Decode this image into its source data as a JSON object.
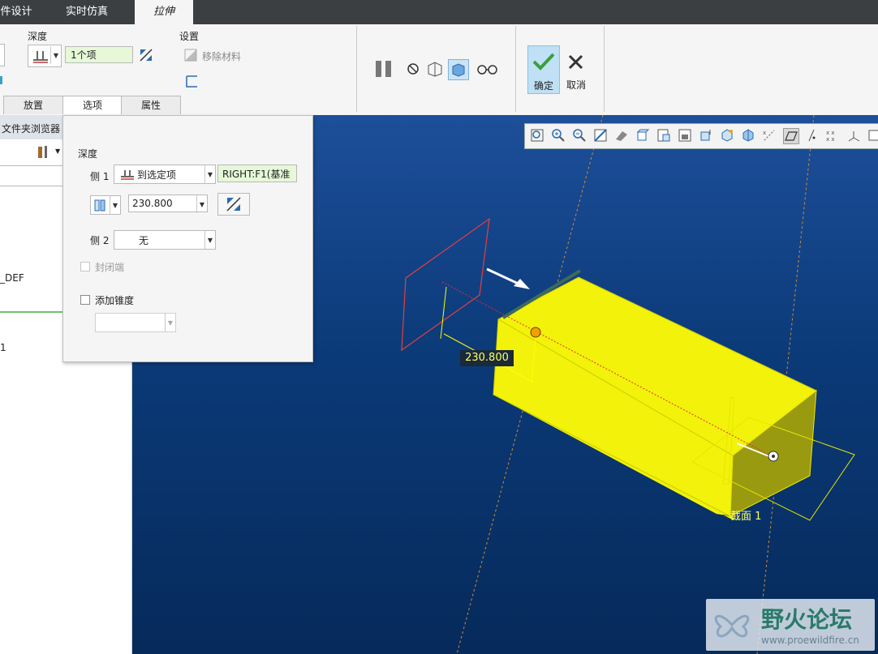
{
  "tabs": [
    {
      "label": "件设计",
      "active": false
    },
    {
      "label": "实时仿真",
      "active": false
    },
    {
      "label": "拉伸",
      "active": true
    }
  ],
  "ribbon": {
    "depth_label": "深度",
    "depth_value": "1个项",
    "settings_label": "设置",
    "remove_material_label": "移除材料",
    "ok_label": "确定",
    "cancel_label": "取消"
  },
  "subtabs": [
    {
      "label": "放置",
      "active": false
    },
    {
      "label": "选项",
      "active": true
    },
    {
      "label": "属性",
      "active": false
    }
  ],
  "left_panel": {
    "browser_label": "文件夹浏览器",
    "tree_item_1": "_DEF",
    "tree_item_2": "1"
  },
  "options": {
    "depth_title": "深度",
    "side1_label": "侧 1",
    "side1_type": "到选定项",
    "side1_reference": "RIGHT:F1(基准",
    "offset_value": "230.800",
    "side2_label": "侧 2",
    "side2_type": "无",
    "capped_ends_label": "封闭端",
    "capped_ends_enabled": false,
    "add_taper_label": "添加锥度",
    "add_taper_checked": false
  },
  "viewport": {
    "dimension_label": "230.800",
    "section_label": "截面 1"
  },
  "watermark": {
    "title": "野火论坛",
    "url": "www.proewildfire.cn"
  },
  "colors": {
    "accent_green": "#3aa03a",
    "model_yellow": "#f2f20a",
    "viewport_blue": "#0b3a78"
  }
}
